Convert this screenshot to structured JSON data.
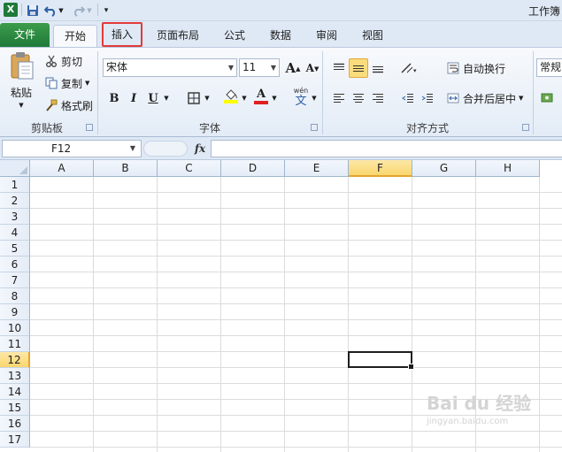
{
  "title_bar": {
    "title": "工作簿"
  },
  "qat": {
    "app_icon": "excel-icon",
    "save": "save-icon",
    "undo": "undo-icon",
    "redo": "redo-icon",
    "customize": "qat-customize-icon"
  },
  "tabs": [
    {
      "label": "文件"
    },
    {
      "label": "开始"
    },
    {
      "label": "插入"
    },
    {
      "label": "页面布局"
    },
    {
      "label": "公式"
    },
    {
      "label": "数据"
    },
    {
      "label": "审阅"
    },
    {
      "label": "视图"
    }
  ],
  "clipboard": {
    "paste": "粘贴",
    "cut": "剪切",
    "copy": "复制",
    "format_painter": "格式刷",
    "group_label": "剪贴板"
  },
  "font": {
    "font_name": "宋体",
    "font_size": "11",
    "bold": "B",
    "italic": "I",
    "underline": "U",
    "font_color_letter": "A",
    "phonetic_top": "wén",
    "phonetic_bottom": "文",
    "grow_letter": "A",
    "shrink_letter": "A",
    "group_label": "字体",
    "fill_color": "#ffff00",
    "font_color": "#e02020"
  },
  "alignment": {
    "wrap_text": "自动换行",
    "merge_center": "合并后居中",
    "group_label": "对齐方式"
  },
  "number": {
    "format": "常规"
  },
  "formula_bar": {
    "name_box": "F12",
    "fx_label": "fx"
  },
  "sheet": {
    "columns": [
      "A",
      "B",
      "C",
      "D",
      "E",
      "F",
      "G",
      "H"
    ],
    "rows": [
      "1",
      "2",
      "3",
      "4",
      "5",
      "6",
      "7",
      "8",
      "9",
      "10",
      "11",
      "12",
      "13",
      "14",
      "15",
      "16",
      "17"
    ],
    "selected_column": "F",
    "selected_row": "12"
  },
  "watermark": {
    "text": "Bai du 经验",
    "sub": "jingyan.baidu.com"
  },
  "colors": {
    "file_tab": "#1f7a3a",
    "highlight_box": "#e23a3a",
    "selection": "#f9d66e"
  }
}
